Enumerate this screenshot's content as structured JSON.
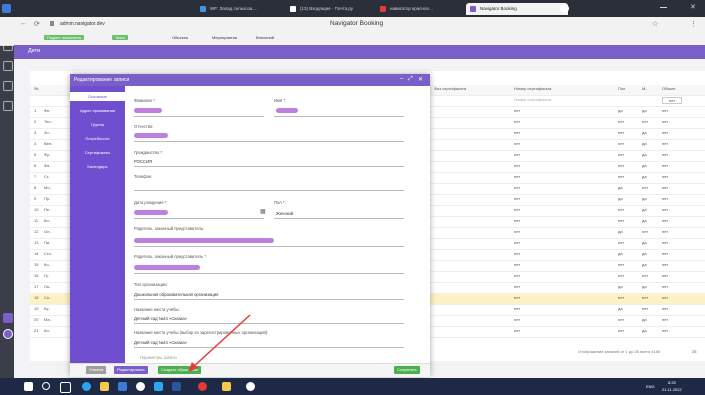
{
  "browser": {
    "tabs": [
      {
        "label": "WF: Запад сельхоза…"
      },
      {
        "label": "(13) Входящие · Почта.ру"
      },
      {
        "label": "навигатор красноя…"
      },
      {
        "label": "Navigator Booking"
      }
    ],
    "active_tab": "Navigator Booking",
    "url": "admin.navigator.dev",
    "page_title": "Navigator Booking"
  },
  "bookmarks": [
    "Подвес назначено",
    "Tasks",
    "Обьекты",
    "Мероприятия",
    "Внесений"
  ],
  "app": {
    "section_title": "Дети"
  },
  "table": {
    "headers": [
      "№",
      "Фамилия",
      "Физ.сертификата",
      "Номер сертификата",
      "Пол",
      "М..",
      "Обязат."
    ],
    "filter_placeholder": "Номер сертификата",
    "filter_value": "нет",
    "rows": [
      {
        "num": "1",
        "col1": "Фе..",
        "cert": "нет",
        "c1": "да",
        "c2": "да",
        "c3": "нет"
      },
      {
        "num": "2",
        "col1": "Тел..",
        "cert": "нет",
        "c1": "нет",
        "c2": "нет",
        "c3": "нет"
      },
      {
        "num": "3",
        "col1": "Зо..",
        "cert": "нет",
        "c1": "нет",
        "c2": "да",
        "c3": "нет"
      },
      {
        "num": "4",
        "col1": "Вен..",
        "cert": "нет",
        "c1": "нет",
        "c2": "да",
        "c3": "нет"
      },
      {
        "num": "5",
        "col1": "Фу..",
        "cert": "нет",
        "c1": "нет",
        "c2": "да",
        "c3": "нет"
      },
      {
        "num": "6",
        "col1": "Фи..",
        "cert": "нет",
        "c1": "нет",
        "c2": "да",
        "c3": "нет"
      },
      {
        "num": "7",
        "col1": "Ст..",
        "cert": "нет",
        "c1": "нет",
        "c2": "да",
        "c3": "нет"
      },
      {
        "num": "8",
        "col1": "Мо..",
        "cert": "нет",
        "c1": "да",
        "c2": "нет",
        "c3": "нет"
      },
      {
        "num": "9",
        "col1": "Пр..",
        "cert": "нет",
        "c1": "да",
        "c2": "да",
        "c3": "нет"
      },
      {
        "num": "10",
        "col1": "Пе..",
        "cert": "нет",
        "c1": "нет",
        "c2": "да",
        "c3": "нет"
      },
      {
        "num": "11",
        "col1": "Ки..",
        "cert": "нет",
        "c1": "нет",
        "c2": "да",
        "c3": "нет"
      },
      {
        "num": "12",
        "col1": "Ол..",
        "cert": "нет",
        "c1": "да",
        "c2": "нет",
        "c3": "нет"
      },
      {
        "num": "13",
        "col1": "Пи..",
        "cert": "нет",
        "c1": "нет",
        "c2": "да",
        "c3": "нет"
      },
      {
        "num": "14",
        "col1": "Сто..",
        "cert": "нет",
        "c1": "да",
        "c2": "да",
        "c3": "нет"
      },
      {
        "num": "15",
        "col1": "Ко..",
        "cert": "нет",
        "c1": "нет",
        "c2": "да",
        "c3": "нет"
      },
      {
        "num": "16",
        "col1": "Гу..",
        "cert": "нет",
        "c1": "нет",
        "c2": "нет",
        "c3": "нет"
      },
      {
        "num": "17",
        "col1": "Ла..",
        "cert": "нет",
        "c1": "да",
        "c2": "да",
        "c3": "нет"
      },
      {
        "num": "18",
        "col1": "Со..",
        "cert": "нет",
        "c1": "нет",
        "c2": "нет",
        "c3": "нет"
      },
      {
        "num": "19",
        "col1": "Ку..",
        "cert": "нет",
        "c1": "да",
        "c2": "нет",
        "c3": "нет"
      },
      {
        "num": "20",
        "col1": "Ма..",
        "cert": "нет",
        "c1": "нет",
        "c2": "да",
        "c3": "нет"
      },
      {
        "num": "21",
        "col1": "Ки..",
        "cert": "нет",
        "c1": "нет",
        "c2": "да",
        "c3": "нет"
      }
    ],
    "pager_text": "Отображение записей от 1 до 25 всего 4180",
    "per_page": "25"
  },
  "modal": {
    "title": "Редактирование записи",
    "nav": [
      "Основные",
      "Адрес проживания",
      "Группа",
      "Потребности",
      "Сертификаты",
      "Календарь"
    ],
    "fields": {
      "last_name_label": "Фамилия *:",
      "first_name_label": "Имя *:",
      "patronymic_label": "Отчество:",
      "citizenship_label": "Гражданство *:",
      "citizenship_value": "РОССИЯ",
      "phone_label": "Телефон:",
      "birth_label": "Дата рождения *:",
      "gender_label": "Пол *:",
      "gender_value": "Женский",
      "rep_label": "Родитель, законный представитель:",
      "rep2_label": "Родитель, законный представитель *:",
      "org_type_label": "Тип организации:",
      "org_type_value": "Дошкольная образовательная организация",
      "school_label": "Название места учёбы:",
      "school_value": "Детский сад №44 «Сказка»",
      "school_reg_label": "Название места учебы (выбор из зарегистрированных организаций):",
      "school_reg_value": "Детский сад №44 «Сказка»",
      "extra_value": "Параметры записи"
    },
    "footer": {
      "cancel": "Отмена",
      "restore": "Редактировать",
      "dup": "Создать обращение",
      "save": "Сохранить"
    }
  },
  "taskbar": {
    "lang": "ENG",
    "time": "8:25",
    "date": "21.11.2022"
  },
  "colors": {
    "accent": "#7b5fc9",
    "nav": "#6f4fd0",
    "highlight": "#fdf2c4",
    "green": "#4caf50"
  }
}
